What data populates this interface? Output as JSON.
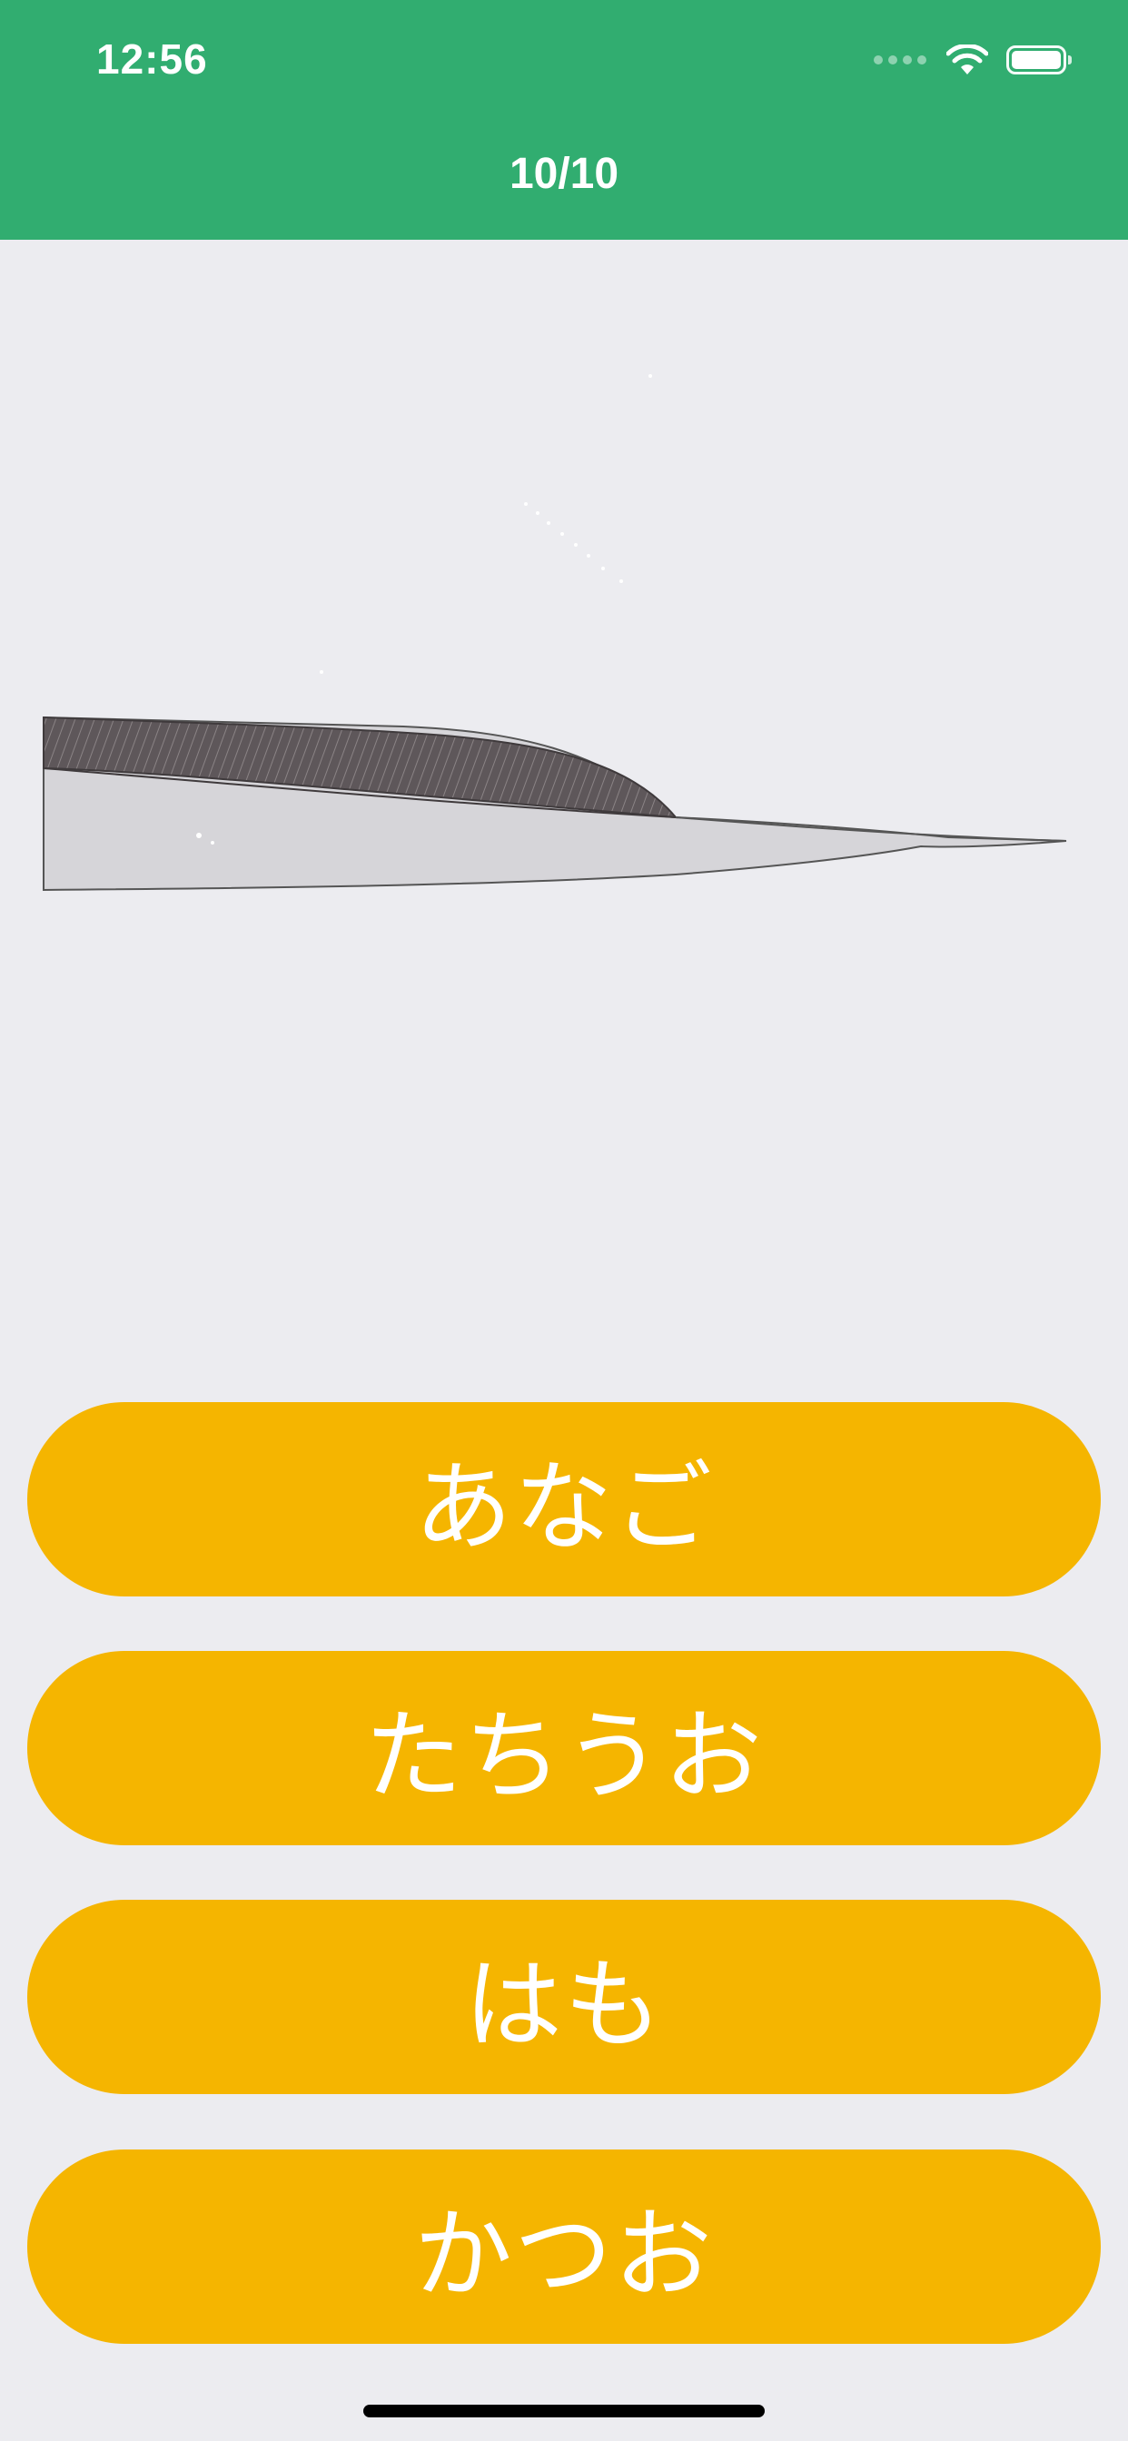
{
  "status_bar": {
    "time": "12:56"
  },
  "header": {
    "progress": "10/10",
    "color": "#31AD70"
  },
  "answers": [
    {
      "label": "あなご"
    },
    {
      "label": "たちうお"
    },
    {
      "label": "はも"
    },
    {
      "label": "かつお"
    }
  ],
  "colors": {
    "background": "#ECECF0",
    "button": "#F5B500",
    "button_text": "#FFFFFF"
  },
  "icons": {
    "signal": "signal-icon",
    "wifi": "wifi-icon",
    "battery": "battery-icon"
  }
}
